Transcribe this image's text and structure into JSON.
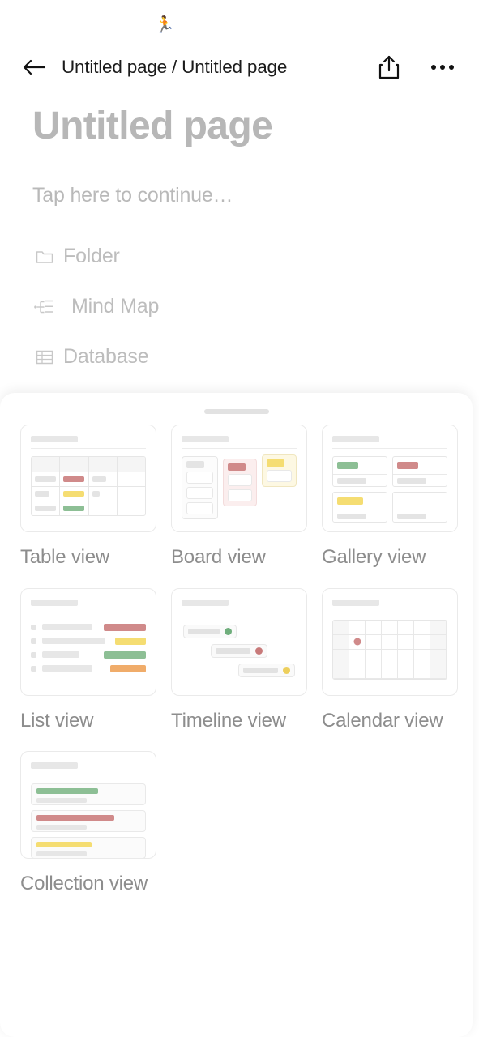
{
  "header": {
    "back_icon": "arrow-left-icon",
    "breadcrumb": "Untitled page / Untitled page",
    "share_icon": "share-icon",
    "more_icon": "more-horizontal-icon"
  },
  "page": {
    "emoji": "🏃",
    "title": "Untitled page",
    "tap_hint": "Tap here to continue…",
    "blocks": [
      {
        "label": "Folder",
        "icon": "folder-icon"
      },
      {
        "label": "Mind Map",
        "icon": "mind-map-icon"
      },
      {
        "label": "Database",
        "icon": "database-icon"
      }
    ]
  },
  "sheet": {
    "handle": "drag-handle",
    "views": [
      {
        "id": "table",
        "label": "Table view"
      },
      {
        "id": "board",
        "label": "Board view"
      },
      {
        "id": "gallery",
        "label": "Gallery view"
      },
      {
        "id": "list",
        "label": "List view"
      },
      {
        "id": "timeline",
        "label": "Timeline view"
      },
      {
        "id": "calendar",
        "label": "Calendar view"
      },
      {
        "id": "collection",
        "label": "Collection view"
      }
    ]
  },
  "colors": {
    "red": "#d08a8a",
    "yellow": "#f5dd72",
    "green": "#8dbf95",
    "orange": "#f0ac6a",
    "neutral": "#e4e4e4",
    "text_muted": "#bdbdbd",
    "label": "#8d8d8d",
    "emoji_tint": "#c98d6b"
  }
}
